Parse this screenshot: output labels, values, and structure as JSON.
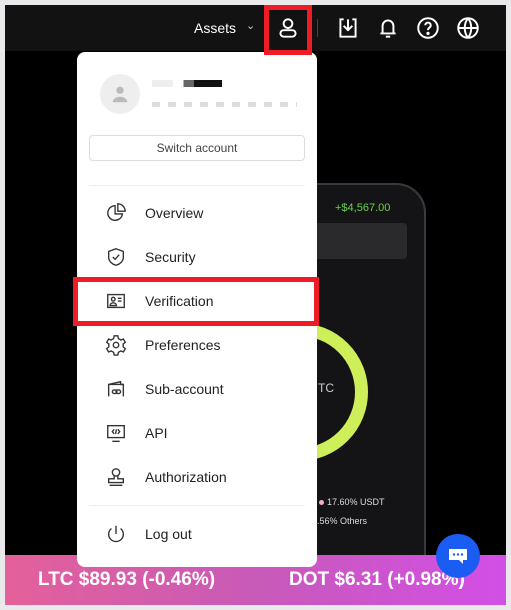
{
  "header": {
    "assets_label": "Assets",
    "icons": [
      "user-icon",
      "download-icon",
      "bell-icon",
      "help-icon",
      "globe-icon"
    ]
  },
  "menu": {
    "switch_account": "Switch account",
    "items": [
      {
        "label": "Overview",
        "icon": "pie-chart-icon"
      },
      {
        "label": "Security",
        "icon": "shield-check-icon"
      },
      {
        "label": "Verification",
        "icon": "id-card-icon"
      },
      {
        "label": "Preferences",
        "icon": "gear-icon"
      },
      {
        "label": "Sub-account",
        "icon": "wallet-link-icon"
      },
      {
        "label": "API",
        "icon": "monitor-code-icon"
      },
      {
        "label": "Authorization",
        "icon": "stamp-icon"
      }
    ],
    "logout": "Log out"
  },
  "background": {
    "pnl": "+$4,567.00",
    "donut_label": "TC",
    "legend": [
      "17.60% USDT",
      ".56% Others"
    ],
    "ticker": [
      "LTC $89.93 (-0.46%)",
      "DOT $6.31 (+0.98%)"
    ]
  },
  "colors": {
    "highlight": "#ee1c25",
    "donut": "#cfef5a",
    "chat": "#1b5cf3",
    "pnl": "#6ad04a"
  }
}
